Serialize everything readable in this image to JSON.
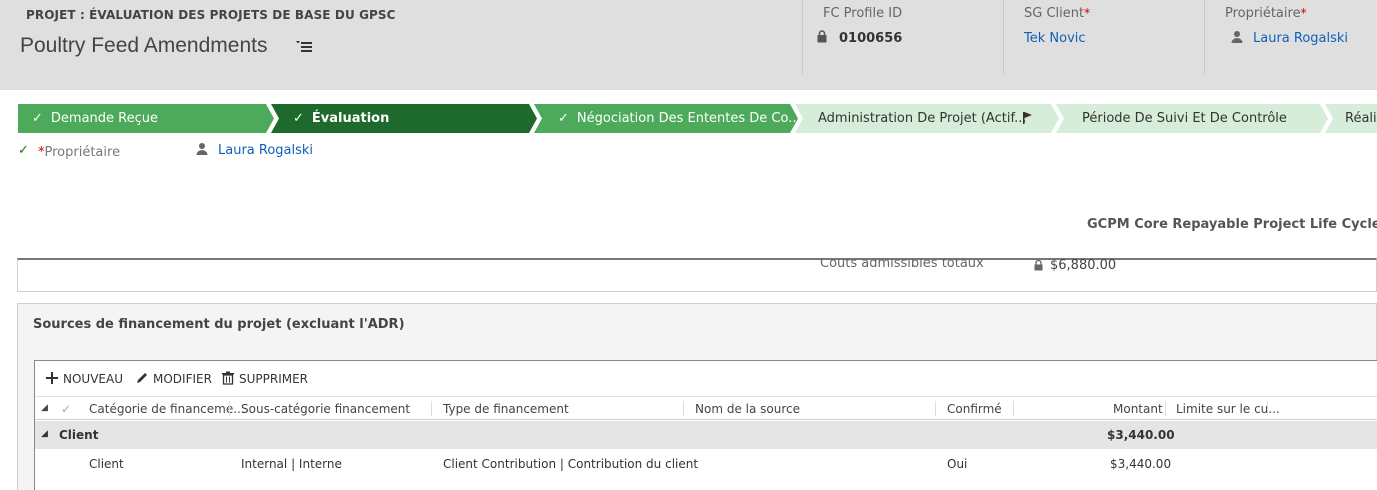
{
  "header": {
    "entity_label": "PROJET : ÉVALUATION DES PROJETS DE BASE DU GPSC",
    "record_title": "Poultry Feed Amendments",
    "fields": {
      "profile_id": {
        "label": "FC Profile ID",
        "value": "0100656"
      },
      "sg_client": {
        "label": "SG Client",
        "required_mark": "*",
        "value": "Tek Novic"
      },
      "owner": {
        "label": "Propriétaire",
        "required_mark": "*",
        "value": "Laura Rogalski"
      }
    }
  },
  "process": {
    "stages": [
      {
        "label": "Demande Reçue",
        "check": "✓",
        "state": "done"
      },
      {
        "label": "Évaluation",
        "check": "✓",
        "state": "active"
      },
      {
        "label": "Négociation Des Ententes De Co...",
        "check": "✓",
        "state": "done"
      },
      {
        "label": "Administration De Projet (Actif...",
        "check": "",
        "state": "future"
      },
      {
        "label": "Période De Suivi Et De Contrôle",
        "check": "",
        "state": "future"
      },
      {
        "label": "Réalis",
        "check": "",
        "state": "future"
      }
    ],
    "stage_field": {
      "check": "✓",
      "required_mark": "*",
      "label": "Propriétaire",
      "value": "Laura Rogalski"
    },
    "lifecycle_name": "GCPM Core Repayable Project Life Cycle (Acti"
  },
  "costs": {
    "label": "Coûts admissibles totaux",
    "value": "$6,880.00"
  },
  "funding": {
    "title": "Sources de financement du projet (excluant l'ADR)",
    "commands": {
      "new": "NOUVEAU",
      "edit": "MODIFIER",
      "delete": "SUPPRIMER"
    },
    "columns": {
      "category": "Catégorie de financeme...",
      "subcategory": "Sous-catégorie financement",
      "type": "Type de financement",
      "source_name": "Nom de la source",
      "confirmed": "Confirmé",
      "amount": "Montant",
      "limit": "Limite sur le cu..."
    },
    "group": {
      "name": "Client",
      "total": "$3,440.00"
    },
    "rows": [
      {
        "category": "Client",
        "subcategory": "Internal | Interne",
        "type": "Client Contribution | Contribution du client",
        "source_name": "",
        "confirmed": "Oui",
        "amount": "$3,440.00"
      }
    ]
  },
  "colors": {
    "header_bg": "#dfdfdf",
    "stage_done": "#4caa5a",
    "stage_active": "#1e6a2c",
    "stage_future": "#d6edd9",
    "link": "#1160b7"
  }
}
